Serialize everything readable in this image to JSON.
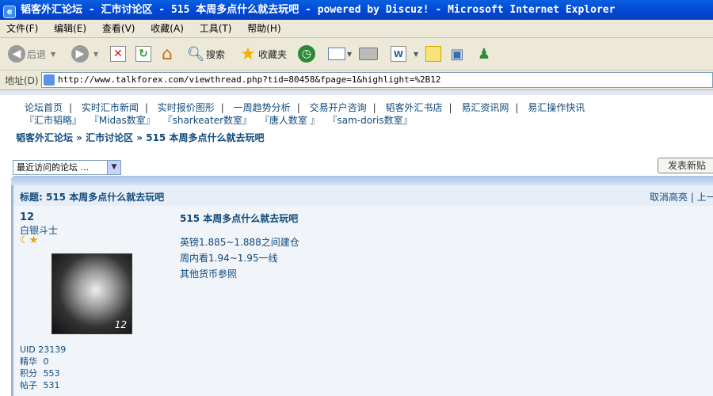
{
  "window": {
    "title": "韬客外汇论坛 - 汇市讨论区 - 515 本周多点什么就去玩吧 - powered by Discuz! - Microsoft Internet Explorer"
  },
  "menu": [
    "文件(F)",
    "编辑(E)",
    "查看(V)",
    "收藏(A)",
    "工具(T)",
    "帮助(H)"
  ],
  "toolbar": {
    "back_label": "后退",
    "search_label": "搜索",
    "favorites_label": "收藏夹"
  },
  "address": {
    "label": "地址(D)",
    "url": "http://www.talkforex.com/viewthread.php?tid=80458&fpage=1&highlight=%2B12"
  },
  "nav": {
    "row1": [
      "论坛首页",
      "实时汇市新闻",
      "实时报价图形",
      "一周趋势分析",
      "交易开户咨询",
      "韬客外汇书店",
      "易汇资讯网",
      "易汇操作快讯"
    ],
    "row2": [
      "『汇市韬略』",
      "『Midas数室』",
      "『sharkeater数室』",
      "『唐人数室 』",
      "『sam-doris数室』"
    ]
  },
  "breadcrumb": "韬客外汇论坛 » 汇市讨论区 » 515 本周多点什么就去玩吧",
  "forum_select": "最近访问的论坛 ...",
  "post_button": "发表新贴",
  "thread": {
    "title": "标题: 515 本周多点什么就去玩吧",
    "head_links": "取消高亮 | 上一"
  },
  "post": {
    "author": "12",
    "rank": "白银斗士",
    "avatar_caption": "12",
    "stats": {
      "uid": "UID 23139",
      "jinghua_label": "精华",
      "jinghua": "0",
      "jifen_label": "积分",
      "jifen": "553",
      "tiezi_label": "帖子",
      "tiezi": "531"
    },
    "title": "515 本周多点什么就去玩吧",
    "body": [
      "英镑1.885~1.888之间建仓",
      "周内看1.94~1.95一线",
      "其他货币参照"
    ]
  }
}
